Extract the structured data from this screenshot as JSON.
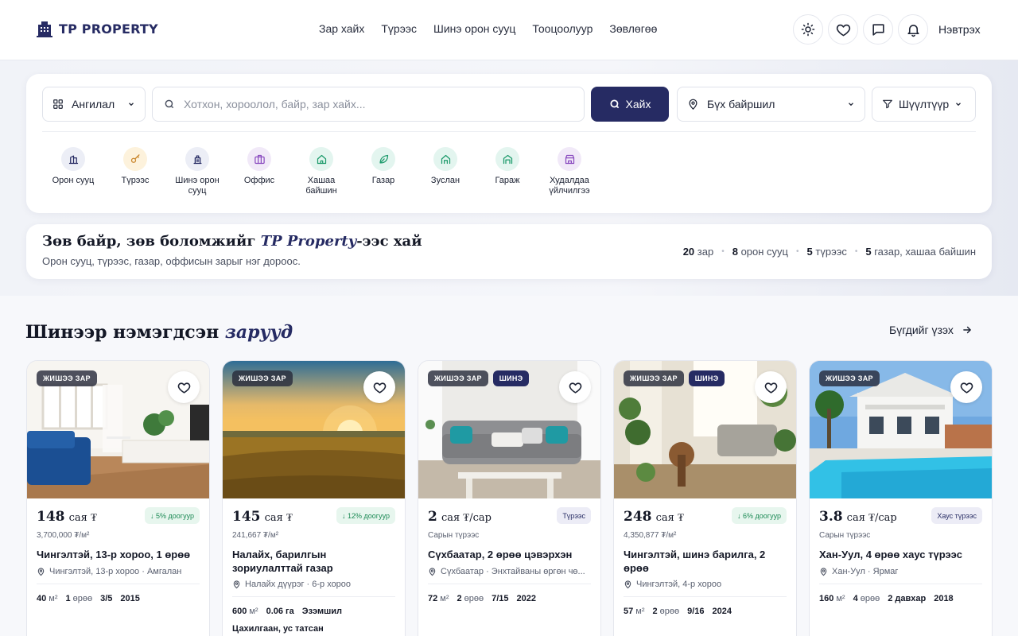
{
  "header": {
    "logo_text": "TP PROPERTY",
    "nav": [
      "Зар хайх",
      "Түрээс",
      "Шинэ орон сууц",
      "Тооцоолуур",
      "Зөвлөгөө"
    ],
    "login_label": "Нэвтрэх"
  },
  "search": {
    "category_label": "Ангилал",
    "placeholder": "Хотхон, хороолол, байр, зар хайх...",
    "button_label": "Хайх",
    "location_label": "Бүх байршил",
    "filter_label": "Шүүлтүүр"
  },
  "categories": [
    {
      "label": "Орон сууц",
      "icon": "building-icon",
      "bg": "#eceef6",
      "fg": "#262b63"
    },
    {
      "label": "Түрээс",
      "icon": "key-icon",
      "bg": "#fdf2dc",
      "fg": "#c9852a"
    },
    {
      "label": "Шинэ орон сууц",
      "icon": "new-building-icon",
      "bg": "#eceef6",
      "fg": "#262b63"
    },
    {
      "label": "Оффис",
      "icon": "briefcase-icon",
      "bg": "#f1e9f8",
      "fg": "#8a4bbf"
    },
    {
      "label": "Хашаа байшин",
      "icon": "house-icon",
      "bg": "#e3f5ef",
      "fg": "#1c9a6b"
    },
    {
      "label": "Газар",
      "icon": "leaf-icon",
      "bg": "#e3f5ef",
      "fg": "#1c9a6b"
    },
    {
      "label": "Зуслан",
      "icon": "cabin-icon",
      "bg": "#e3f5ef",
      "fg": "#1c9a6b"
    },
    {
      "label": "Гараж",
      "icon": "garage-icon",
      "bg": "#e3f5ef",
      "fg": "#1c9a6b"
    },
    {
      "label": "Худалдаа үйлчилгээ",
      "icon": "store-icon",
      "bg": "#f1e9f8",
      "fg": "#8a4bbf"
    }
  ],
  "info": {
    "title_pre": "Зөв байр, зөв боломжийг ",
    "title_brand": "TP Property",
    "title_post": "-ээс хай",
    "subtitle": "Орон сууц, түрээс, газар, оффисын зарыг нэг дороос.",
    "stats": [
      {
        "num": "20",
        "label": "зар"
      },
      {
        "num": "8",
        "label": "орон сууц"
      },
      {
        "num": "5",
        "label": "түрээс"
      },
      {
        "num": "5",
        "label": "газар, хашаа байшин"
      }
    ]
  },
  "section": {
    "title_main": "Шинээр нэмэгдсэн ",
    "title_accent": "зарууд",
    "see_all": "Бүгдийг үзэх"
  },
  "badge_sample": "ЖИШЭЭ ЗАР",
  "badge_new": "ШИНЭ",
  "listings": [
    {
      "price_num": "148",
      "price_unit": "сая ₮",
      "chip": "↓ 5% доогуур",
      "chip_kind": "green",
      "sub": "3,700,000 ₮/м²",
      "title": "Чингэлтэй, 13-р хороо, 1 өрөө",
      "location": "Чингэлтэй, 13-р хороо · Амгалан",
      "new": false,
      "specs": [
        [
          "40",
          "м²"
        ],
        [
          "1",
          "өрөө"
        ],
        [
          "3/5",
          ""
        ],
        [
          "2015",
          ""
        ]
      ],
      "extra": ""
    },
    {
      "price_num": "145",
      "price_unit": "сая ₮",
      "chip": "↓ 12% доогуур",
      "chip_kind": "green",
      "sub": "241,667 ₮/м²",
      "title": "Налайх, барилгын зориулалттай газар",
      "location": "Налайх дүүрэг · 6-р хороо",
      "new": false,
      "specs": [
        [
          "600",
          "м²"
        ],
        [
          "0.06 га",
          ""
        ],
        [
          "Эзэмшил",
          ""
        ]
      ],
      "extra": "Цахилгаан, ус татсан"
    },
    {
      "price_num": "2",
      "price_unit": "сая ₮/сар",
      "chip": "Түрээс",
      "chip_kind": "type",
      "sub": "Сарын түрээс",
      "title": "Сүхбаатар, 2 өрөө цэвэрхэн",
      "location": "Сүхбаатар · Энхтайваны өргөн чө...",
      "new": true,
      "specs": [
        [
          "72",
          "м²"
        ],
        [
          "2",
          "өрөө"
        ],
        [
          "7/15",
          ""
        ],
        [
          "2022",
          ""
        ]
      ],
      "extra": ""
    },
    {
      "price_num": "248",
      "price_unit": "сая ₮",
      "chip": "↓ 6% доогуур",
      "chip_kind": "green",
      "sub": "4,350,877 ₮/м²",
      "title": "Чингэлтэй, шинэ барилга, 2 өрөө",
      "location": "Чингэлтэй, 4-р хороо",
      "new": true,
      "specs": [
        [
          "57",
          "м²"
        ],
        [
          "2",
          "өрөө"
        ],
        [
          "9/16",
          ""
        ],
        [
          "2024",
          ""
        ]
      ],
      "extra": ""
    },
    {
      "price_num": "3.8",
      "price_unit": "сая ₮/сар",
      "chip": "Хаус түрээс",
      "chip_kind": "type",
      "sub": "Сарын түрээс",
      "title": "Хан-Уул, 4 өрөө хаус түрээс",
      "location": "Хан-Уул · Ярмаг",
      "new": false,
      "specs": [
        [
          "160",
          "м²"
        ],
        [
          "4",
          "өрөө"
        ],
        [
          "2 давхар",
          ""
        ],
        [
          "2018",
          ""
        ]
      ],
      "extra": ""
    }
  ]
}
